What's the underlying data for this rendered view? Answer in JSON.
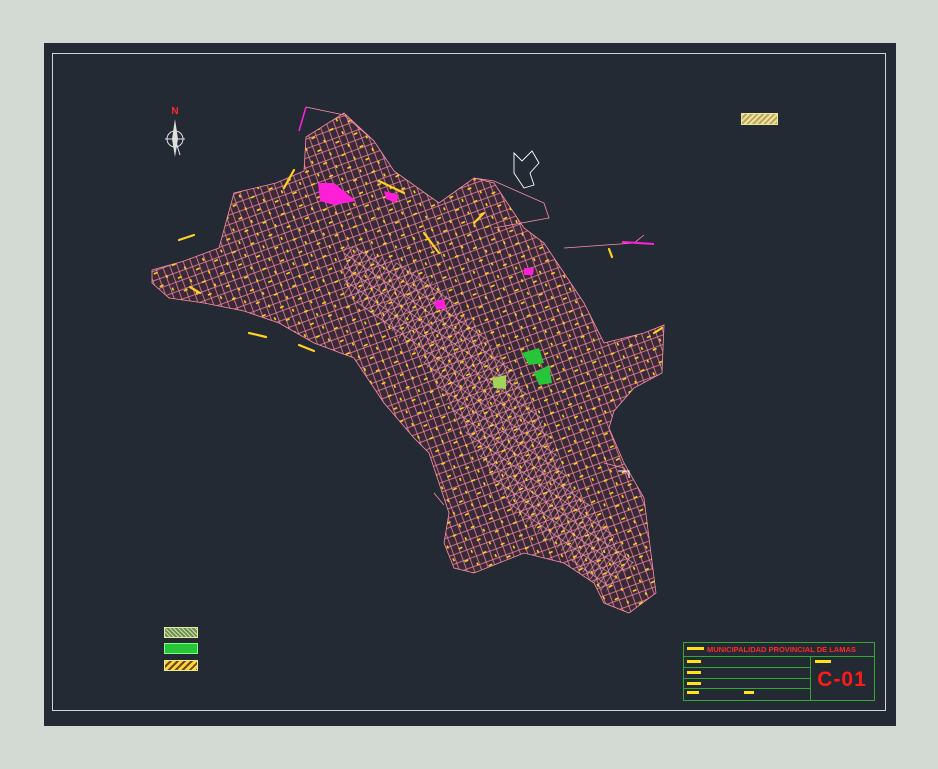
{
  "north_arrow": {
    "letter": "N",
    "icon": "north-arrow-icon"
  },
  "title_block": {
    "title": "MUNICIPALIDAD PROVINCIAL DE LAMAS",
    "sheet_code": "C-01"
  },
  "colors": {
    "background": "#d3dad4",
    "sheet": "#242a34",
    "parcels": "#ff8fa6",
    "streets": "#ffd21f",
    "green_areas": "#27c53a",
    "special_zones": "#ff1fd8",
    "title_text": "#ff2a2a",
    "title_frame": "#2faa2f"
  },
  "legend": [
    {
      "icon": "green-hatch-swatch"
    },
    {
      "icon": "green-fill-swatch"
    },
    {
      "icon": "yellow-hatch-swatch"
    }
  ]
}
